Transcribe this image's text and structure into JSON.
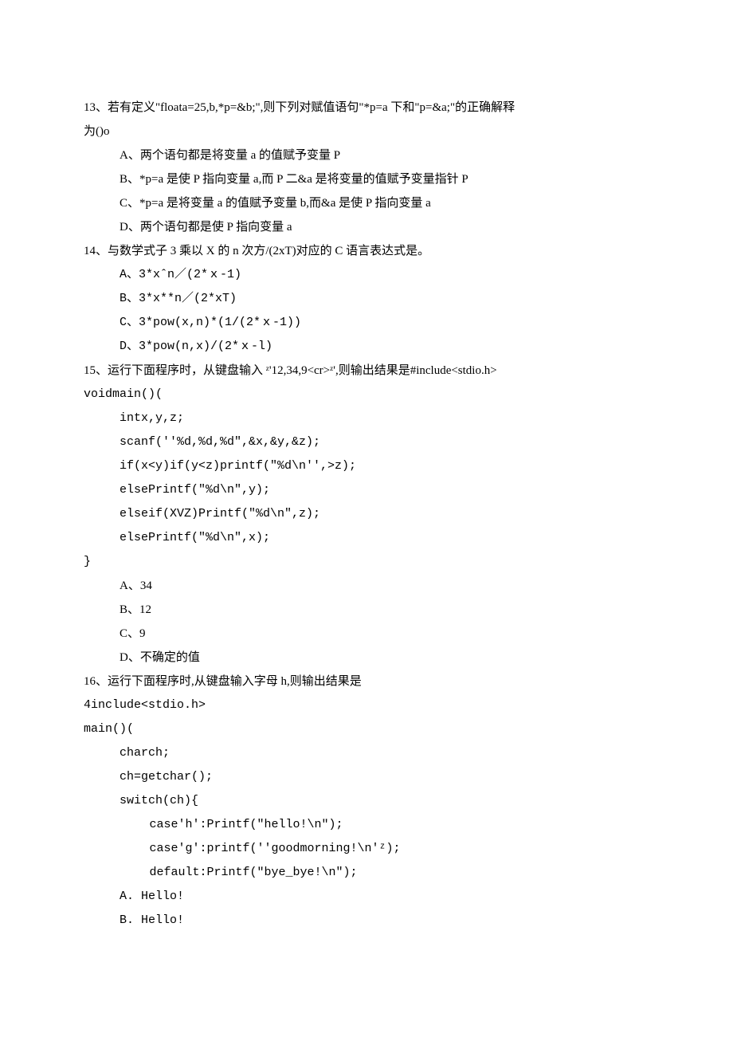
{
  "q13": {
    "stem1": "13、若有定义\"floata=25,b,*p=&b;\",则下列对赋值语句\"*p=a 下和\"p=&a;\"的正确解释",
    "stem2": "为()o",
    "A": "A、两个语句都是将变量 a 的值赋予变量 P",
    "B": "B、*p=a 是使 P 指向变量 a,而 P 二&a 是将变量的值赋予变量指针 P",
    "C": "C、*p=a 是将变量 a 的值赋予变量 b,而&a 是使 P 指向变量 a",
    "D": "D、两个语句都是使 P 指向变量 a"
  },
  "q14": {
    "stem": "14、与数学式子 3 乘以 X 的 n 次方/(2xT)对应的 C 语言表达式是。",
    "A": "A、3*xˆn／(2*ｘ-1)",
    "B": "B、3*x**n／(2*xT)",
    "C": "C、3*pow(x,n)*(1/(2*ｘ-1))",
    "D": "D、3*pow(n,x)/(2*ｘ-l)"
  },
  "q15": {
    "stem1": "15、运行下面程序时，从键盘输入 ᶻ'12,34,9<cr>ᶻ',则输出结果是#include<stdio.h>",
    "stem2": "voidmain()(",
    "c1": "intx,y,z;",
    "c2": "scanf(''%d,%d,%d\",&x,&y,&z);",
    "c3": "if(x<y)if(y<z)printf(\"%d\\n'',>z);",
    "c4": "elsePrintf(\"%d\\n\",y);",
    "c5": "elseif(XVZ)Printf(\"%d\\n\",z);",
    "c6": "elsePrintf(\"%d\\n\",x);",
    "c7": "}",
    "A": "A、34",
    "B": "B、12",
    "C": "C、9",
    "D": "D、不确定的值"
  },
  "q16": {
    "stem": "16、运行下面程序时,从键盘输入字母 h,则输出结果是",
    "c0": "4include<stdio.h>",
    "c1": "main()(",
    "c2": "charch;",
    "c3": "ch=getchar();",
    "c4": "switch(ch){",
    "c5": "case'h':Printf(\"hello!\\nʺ);",
    "c6": "case'g':printf(''goodmorning!\\n'ᶻ);",
    "c7": "default:Printf(ʺbye_bye!\\n\");",
    "A": "A.  Hello!",
    "B": "B.  Hello!"
  }
}
